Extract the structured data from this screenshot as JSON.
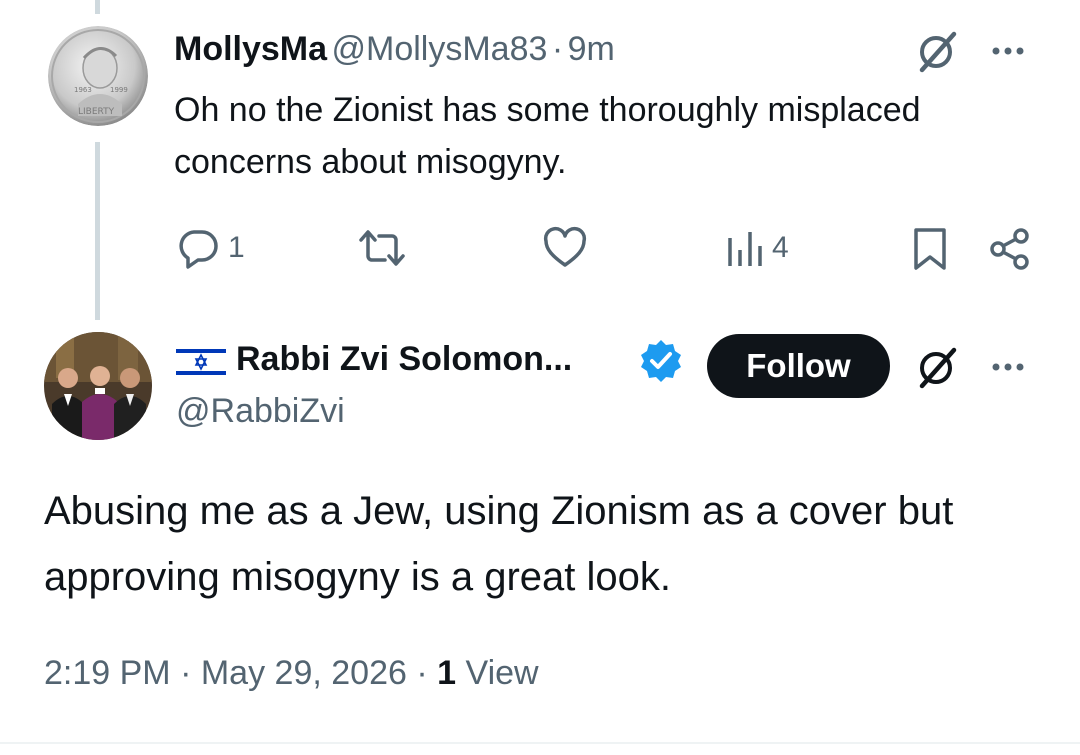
{
  "reply": {
    "display_name": "MollysMa",
    "handle": "@MollysMa83",
    "separator": "·",
    "time": "9m",
    "text": "Oh no the Zionist has some thoroughly misplaced concerns about misogyny.",
    "actions": {
      "reply_count": "1",
      "retweet_count": "",
      "like_count": "",
      "views_count": "4"
    },
    "avatar_text": {
      "word": "LIBERTY",
      "year_left": "1963",
      "year_right": "1999"
    }
  },
  "main_tweet": {
    "flag_icon": "israel-flag-icon",
    "display_name": "Rabbi Zvi Solomon...",
    "verified_icon": "verified-badge-icon",
    "handle": "@RabbiZvi",
    "follow_label": "Follow",
    "text": "Abusing me as a Jew, using Zionism as a cover but approving misogyny is a great look.",
    "time": "2:19 PM",
    "date": "May 29, 2026",
    "view_count": "1",
    "view_label": "View"
  },
  "colors": {
    "text_primary": "#0f1419",
    "text_secondary": "#536471",
    "verified_blue": "#1d9bf0",
    "follow_bg": "#0f1419",
    "thread_line": "#cfd9de",
    "flag_blue": "#0038b8"
  },
  "icons": [
    "grok-icon",
    "more-icon",
    "reply-icon",
    "retweet-icon",
    "like-icon",
    "views-icon",
    "bookmark-icon",
    "share-icon"
  ]
}
